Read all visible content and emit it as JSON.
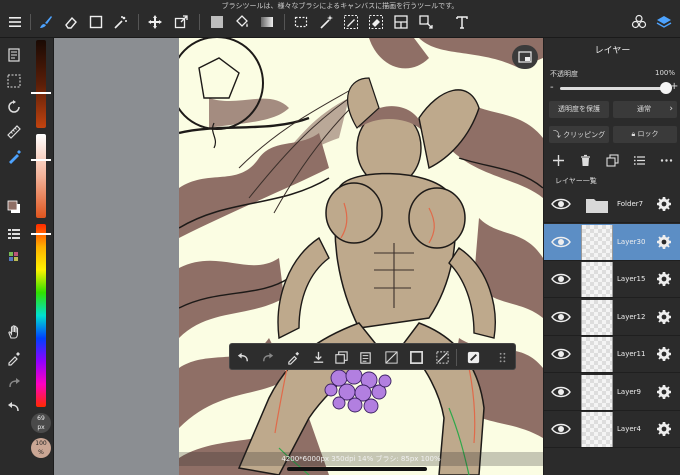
{
  "hint_text": "ブラシツールは、様々なブラシによるキャンバスに描画を行うツールです。",
  "top_toolbar": {
    "items": [
      "menu-icon",
      "brush-icon",
      "eraser-icon",
      "select-rect-icon",
      "transform-icon",
      "move-icon",
      "crop-icon",
      "fill-color-icon",
      "bucket-icon",
      "gradient-icon",
      "rect-select-icon",
      "magic-wand-icon",
      "select-pen-icon",
      "select-eraser-icon",
      "layout-icon",
      "lasso-fill-icon",
      "text-icon",
      "materials-icon",
      "layers-icon"
    ]
  },
  "left_toolbar": {
    "brush_size_label": "69",
    "brush_size_unit": "px",
    "opacity_label": "100",
    "opacity_unit": "%"
  },
  "canvas": {
    "status": "4200*6000px 350dpi 14% ブラシ: 85px 100%"
  },
  "layer_panel": {
    "title": "レイヤー",
    "opacity_label": "不透明度",
    "opacity_value": "100%",
    "opacity_fraction": 1.0,
    "minus_label": "-",
    "plus_label": "+",
    "protect_alpha_label": "透明度を保護",
    "blend_mode_label": "通常",
    "clipping_label": "クリッピング",
    "lock_label": "ロック",
    "list_header": "レイヤー一覧",
    "layers": [
      {
        "name": "Folder7",
        "type": "folder",
        "selected": false
      },
      {
        "name": "Layer30",
        "type": "layer",
        "selected": true
      },
      {
        "name": "Layer15",
        "type": "layer",
        "selected": false
      },
      {
        "name": "Layer12",
        "type": "layer",
        "selected": false
      },
      {
        "name": "Layer11",
        "type": "layer",
        "selected": false
      },
      {
        "name": "Layer9",
        "type": "layer",
        "selected": false
      },
      {
        "name": "Layer4",
        "type": "layer",
        "selected": false
      }
    ]
  },
  "colors": {
    "ui_dark": "#2b2b2b",
    "selection_blue": "#5c8ec5",
    "canvas_paper": "#fbfde3",
    "art_shadow": "#8f6f66"
  }
}
